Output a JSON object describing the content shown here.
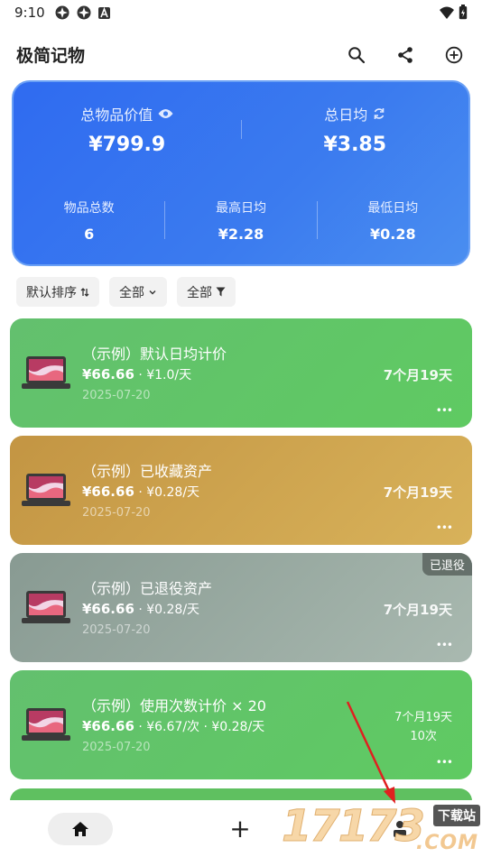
{
  "status_bar": {
    "time": "9:10"
  },
  "header": {
    "title": "极简记物"
  },
  "summary": {
    "total_value_label": "总物品价值",
    "total_value": "¥799.9",
    "daily_avg_label": "总日均",
    "daily_avg": "¥3.85",
    "item_count_label": "物品总数",
    "item_count": "6",
    "max_daily_label": "最高日均",
    "max_daily": "¥2.28",
    "min_daily_label": "最低日均",
    "min_daily": "¥0.28"
  },
  "filters": {
    "sort_label": "默认排序",
    "category_label": "全部",
    "status_label": "全部"
  },
  "items": [
    {
      "name": "（示例）默认日均计价",
      "price": "¥66.66",
      "rate": " · ¥1.0/天",
      "date": "2025-07-20",
      "duration": "7个月19天",
      "more": "•••"
    },
    {
      "name": "（示例）已收藏资产",
      "price": "¥66.66",
      "rate": " · ¥0.28/天",
      "date": "2025-07-20",
      "duration": "7个月19天",
      "more": "•••"
    },
    {
      "name": "（示例）已退役资产",
      "price": "¥66.66",
      "rate": " · ¥0.28/天",
      "date": "2025-07-20",
      "duration": "7个月19天",
      "more": "•••",
      "badge": "已退役"
    },
    {
      "name": "（示例）使用次数计价 × 20",
      "price": "¥66.66",
      "rate": " · ¥6.67/次 · ¥0.28/天",
      "date": "2025-07-20",
      "duration": "7个月19天",
      "uses": "10次",
      "more": "•••"
    }
  ],
  "nav": {
    "add_glyph": "+"
  },
  "watermark": {
    "digits": "17173",
    "label": "下载站",
    "com": ".COM"
  },
  "colors": {
    "summary_bg": "#3474f0",
    "green": "#5fc060",
    "gold": "#c99b45",
    "gray": "#93a59c"
  }
}
